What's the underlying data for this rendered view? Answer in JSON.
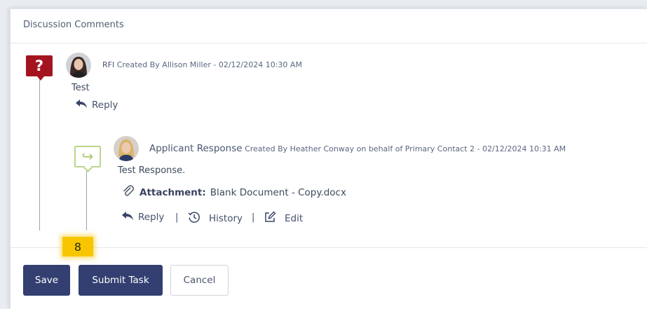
{
  "section": {
    "title": "Discussion Comments"
  },
  "comments": [
    {
      "type_label": "RFI",
      "meta": "Created By Allison Miller - 02/12/2024 10:30 AM",
      "body": "Test",
      "icon_char": "?",
      "actions": {
        "reply": "Reply"
      }
    },
    {
      "type_label": "Applicant Response",
      "meta": "Created By Heather Conway on behalf of Primary Contact 2 - 02/12/2024 10:31 AM",
      "body": "Test Response.",
      "icon_char": "↪",
      "attachment": {
        "label": "Attachment:",
        "filename": "Blank Document - Copy.docx"
      },
      "actions": {
        "reply": "Reply",
        "history": "History",
        "edit": "Edit",
        "separator": "|"
      }
    }
  ],
  "step_badge": "8",
  "buttons": {
    "save": "Save",
    "submit": "Submit Task",
    "cancel": "Cancel"
  },
  "colors": {
    "primary_button": "#323f70",
    "rfi_icon": "#a4141e",
    "response_icon_border": "#bdd48a",
    "badge": "#f7c600"
  }
}
